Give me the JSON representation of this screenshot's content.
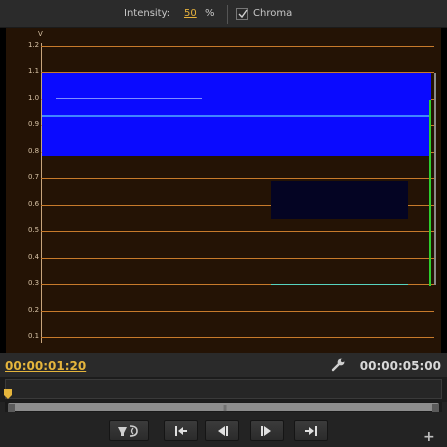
{
  "toolbar": {
    "intensity_label": "Intensity:",
    "intensity_value": "50",
    "intensity_unit": "%",
    "chroma_label": "Chroma",
    "chroma_checked": true
  },
  "scope": {
    "unit_label": "V",
    "y_ticks": [
      "1.2",
      "1.1",
      "1.0",
      "0.9",
      "0.8",
      "0.7",
      "0.6",
      "0.5",
      "0.4",
      "0.3",
      "0.2",
      "0.1"
    ]
  },
  "timecodes": {
    "current": "00:00:01:20",
    "duration": "00:00:05:00"
  },
  "icons": {
    "settings": "wrench-icon",
    "output": "output-toggle-icon",
    "go_in": "go-to-in-point-icon",
    "step_back": "step-back-icon",
    "step_forward": "step-forward-icon",
    "go_out": "go-to-out-point-icon",
    "add": "plus-icon"
  },
  "colors": {
    "accent": "#e5b53c",
    "grid": "#c77a2b",
    "signal_blue": "#0a0aff",
    "signal_green": "#2ecf2e"
  }
}
